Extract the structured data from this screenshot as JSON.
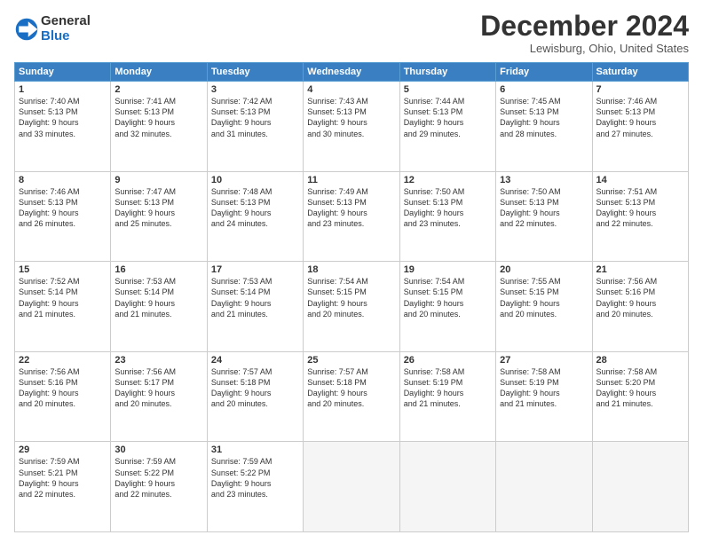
{
  "logo": {
    "general": "General",
    "blue": "Blue"
  },
  "title": "December 2024",
  "location": "Lewisburg, Ohio, United States",
  "headers": [
    "Sunday",
    "Monday",
    "Tuesday",
    "Wednesday",
    "Thursday",
    "Friday",
    "Saturday"
  ],
  "weeks": [
    [
      {
        "day": "1",
        "sunrise": "7:40 AM",
        "sunset": "5:13 PM",
        "daylight": "9 hours and 33 minutes."
      },
      {
        "day": "2",
        "sunrise": "7:41 AM",
        "sunset": "5:13 PM",
        "daylight": "9 hours and 32 minutes."
      },
      {
        "day": "3",
        "sunrise": "7:42 AM",
        "sunset": "5:13 PM",
        "daylight": "9 hours and 31 minutes."
      },
      {
        "day": "4",
        "sunrise": "7:43 AM",
        "sunset": "5:13 PM",
        "daylight": "9 hours and 30 minutes."
      },
      {
        "day": "5",
        "sunrise": "7:44 AM",
        "sunset": "5:13 PM",
        "daylight": "9 hours and 29 minutes."
      },
      {
        "day": "6",
        "sunrise": "7:45 AM",
        "sunset": "5:13 PM",
        "daylight": "9 hours and 28 minutes."
      },
      {
        "day": "7",
        "sunrise": "7:46 AM",
        "sunset": "5:13 PM",
        "daylight": "9 hours and 27 minutes."
      }
    ],
    [
      {
        "day": "8",
        "sunrise": "7:46 AM",
        "sunset": "5:13 PM",
        "daylight": "9 hours and 26 minutes."
      },
      {
        "day": "9",
        "sunrise": "7:47 AM",
        "sunset": "5:13 PM",
        "daylight": "9 hours and 25 minutes."
      },
      {
        "day": "10",
        "sunrise": "7:48 AM",
        "sunset": "5:13 PM",
        "daylight": "9 hours and 24 minutes."
      },
      {
        "day": "11",
        "sunrise": "7:49 AM",
        "sunset": "5:13 PM",
        "daylight": "9 hours and 23 minutes."
      },
      {
        "day": "12",
        "sunrise": "7:50 AM",
        "sunset": "5:13 PM",
        "daylight": "9 hours and 23 minutes."
      },
      {
        "day": "13",
        "sunrise": "7:50 AM",
        "sunset": "5:13 PM",
        "daylight": "9 hours and 22 minutes."
      },
      {
        "day": "14",
        "sunrise": "7:51 AM",
        "sunset": "5:13 PM",
        "daylight": "9 hours and 22 minutes."
      }
    ],
    [
      {
        "day": "15",
        "sunrise": "7:52 AM",
        "sunset": "5:14 PM",
        "daylight": "9 hours and 21 minutes."
      },
      {
        "day": "16",
        "sunrise": "7:53 AM",
        "sunset": "5:14 PM",
        "daylight": "9 hours and 21 minutes."
      },
      {
        "day": "17",
        "sunrise": "7:53 AM",
        "sunset": "5:14 PM",
        "daylight": "9 hours and 21 minutes."
      },
      {
        "day": "18",
        "sunrise": "7:54 AM",
        "sunset": "5:15 PM",
        "daylight": "9 hours and 20 minutes."
      },
      {
        "day": "19",
        "sunrise": "7:54 AM",
        "sunset": "5:15 PM",
        "daylight": "9 hours and 20 minutes."
      },
      {
        "day": "20",
        "sunrise": "7:55 AM",
        "sunset": "5:15 PM",
        "daylight": "9 hours and 20 minutes."
      },
      {
        "day": "21",
        "sunrise": "7:56 AM",
        "sunset": "5:16 PM",
        "daylight": "9 hours and 20 minutes."
      }
    ],
    [
      {
        "day": "22",
        "sunrise": "7:56 AM",
        "sunset": "5:16 PM",
        "daylight": "9 hours and 20 minutes."
      },
      {
        "day": "23",
        "sunrise": "7:56 AM",
        "sunset": "5:17 PM",
        "daylight": "9 hours and 20 minutes."
      },
      {
        "day": "24",
        "sunrise": "7:57 AM",
        "sunset": "5:18 PM",
        "daylight": "9 hours and 20 minutes."
      },
      {
        "day": "25",
        "sunrise": "7:57 AM",
        "sunset": "5:18 PM",
        "daylight": "9 hours and 20 minutes."
      },
      {
        "day": "26",
        "sunrise": "7:58 AM",
        "sunset": "5:19 PM",
        "daylight": "9 hours and 21 minutes."
      },
      {
        "day": "27",
        "sunrise": "7:58 AM",
        "sunset": "5:19 PM",
        "daylight": "9 hours and 21 minutes."
      },
      {
        "day": "28",
        "sunrise": "7:58 AM",
        "sunset": "5:20 PM",
        "daylight": "9 hours and 21 minutes."
      }
    ],
    [
      {
        "day": "29",
        "sunrise": "7:59 AM",
        "sunset": "5:21 PM",
        "daylight": "9 hours and 22 minutes."
      },
      {
        "day": "30",
        "sunrise": "7:59 AM",
        "sunset": "5:22 PM",
        "daylight": "9 hours and 22 minutes."
      },
      {
        "day": "31",
        "sunrise": "7:59 AM",
        "sunset": "5:22 PM",
        "daylight": "9 hours and 23 minutes."
      },
      null,
      null,
      null,
      null
    ]
  ],
  "labels": {
    "sunrise": "Sunrise:",
    "sunset": "Sunset:",
    "daylight": "Daylight:"
  }
}
